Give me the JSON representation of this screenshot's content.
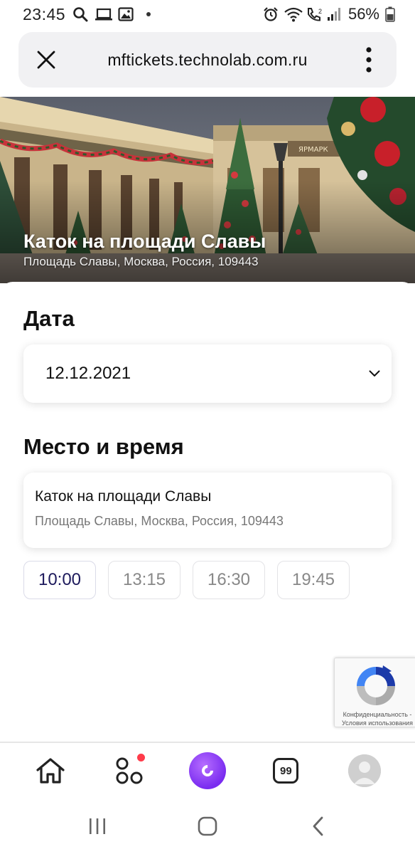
{
  "status_bar": {
    "time": "23:45",
    "battery": "56%",
    "icons_left": [
      "search-icon",
      "laptop-icon",
      "image-icon",
      "dot-icon"
    ],
    "icons_right": [
      "alarm-icon",
      "wifi-icon",
      "volte-call-icon",
      "signal-icon",
      "battery-icon"
    ]
  },
  "browser": {
    "url": "mftickets.technolab.com.ru",
    "close_icon": "close-icon",
    "menu_icon": "more-vertical-icon"
  },
  "hero": {
    "title": "Каток на площади Славы",
    "subtitle": "Площадь Славы, Москва, Россия, 109443"
  },
  "date_section": {
    "title": "Дата",
    "selected_date": "12.12.2021",
    "dropdown_icon": "chevron-down-icon"
  },
  "venue_section": {
    "title": "Место и время",
    "venue_name": "Каток на площади Славы",
    "venue_address": "Площадь Славы, Москва, Россия, 109443",
    "times": [
      {
        "label": "10:00",
        "selected": true
      },
      {
        "label": "13:15",
        "selected": false
      },
      {
        "label": "16:30",
        "selected": false
      },
      {
        "label": "19:45",
        "selected": false
      }
    ]
  },
  "recaptcha": {
    "privacy": "Конфиденциальность",
    "separator": " - ",
    "terms": "Условия использования"
  },
  "bottom_nav": {
    "items": [
      "home-icon",
      "services-icon",
      "alice-icon",
      "99-icon",
      "profile-avatar"
    ],
    "badge_99": "99",
    "services_has_notification": true,
    "alice_color": "#8a3ffc",
    "notification_color": "#ff3b4a"
  },
  "system_nav": [
    "recents-icon",
    "home-circle-icon",
    "back-icon"
  ],
  "colors": {
    "accent_selected_time": "#1d1a5c",
    "muted_text": "#777777"
  }
}
